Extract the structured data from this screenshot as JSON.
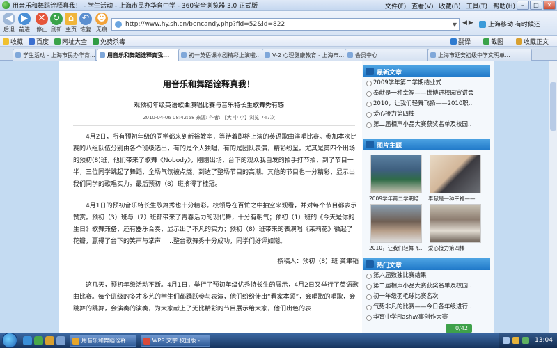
{
  "window": {
    "title": "用音乐和舞蹈诠释真我！ - 学生活动 - 上海市民办华育中学 - 360安全浏览器 3.0 正式版"
  },
  "menu": [
    "文件(F)",
    "查看(V)",
    "收藏(B)",
    "工具(T)",
    "帮助(H)"
  ],
  "nav": {
    "back": "后退",
    "forward": "前进",
    "stop": "停止",
    "refresh": "刷新",
    "home": "主页",
    "restore": "恢复",
    "no_image": "无痕",
    "url": "http://www.hy.sh.cn/bencandy.php?fid=52&id=822",
    "mobile": "上海移动 有时候还"
  },
  "favorites": {
    "items": [
      "收藏",
      "百度",
      "网址大全",
      "免费杀毒"
    ],
    "right": [
      "翻译",
      "截图",
      "收藏正文"
    ]
  },
  "tabs": [
    "学生活动 - 上海市民办华育...",
    "用音乐和舞蹈诠释真我...",
    "初一英语课本剧精彩上演啦...",
    "V-2 心理健康教育 - 上海市...",
    "会员中心",
    "上海市延安初级中学文明单..."
  ],
  "article": {
    "title": "用音乐和舞蹈诠释真我！",
    "subtitle": "观预初年级英语歌曲演唱比赛与音乐特长生歌舞秀有感",
    "meta": "2010-04-06 08:42:58 来源: 作者: 【大 中 小】浏览:747次",
    "p1": "4月2日，所有预初年级的同学都来到新裕教室，等待着即将上演的英语歌曲演唱比赛。参加本次比赛的八组队伍分别由各个班级选出，有的是个人独唱，有的是团队表演，精彩纷呈。尤其是第四个出场的预初(8)班，他们带来了歌舞《Nobody》，刚刚出场，台下的观众我自发的拍手打节拍，到了节目一半，三位同学跳起了舞蹈，全场气氛被点燃，到达了整场节目的高潮。其他的节目也十分精彩，显示出我们同学的歌唱实力。最后预初（8）班摘得了桂冠。",
    "p2": "4月1日的预初音乐特长生歌舞秀也十分精彩。校领导在百忙之中抽空来观看，并对每个节目都表示赞赏。预初（3）班与（7）班都带来了青春活力的现代舞，十分有朝气；预初（1）班的《今天是你的生日》歌舞兼备，还有器乐合奏，显示出了不凡的实力；预初（8）班带来的表演唱《茉莉花》徽起了花瓣，赢得了台下的笑声与掌声……整台歌舞秀十分成功，同学们好评如潮。",
    "sign": "撰稿人：预初（8）班 龚聿韬",
    "p3": "这几天，预初年级活动不断。4月1日，举行了预初年级优秀特长生的展示，4月2日又举行了英语歌曲比赛。每个班级的多才多艺的学生们都踊跃参与表演，他们纷纷使出“看家本领”，会唱歌的唱歌，会跳舞的跳舞，会演奏的演奏，为大家献上了无比精彩的节目展示给大家，他们出色的表"
  },
  "sidebar": {
    "latest_head": "最新文章",
    "latest": [
      "2009学年第二学期结业式",
      "奉献是一种幸福——世博进校园宣讲会",
      "2010，让我们轻舞飞扬——2010职..",
      "爱心接力第四棒",
      "第二届相声小品大赛获奖名单及校园.."
    ],
    "photo_head": "图片主题",
    "photos": [
      "2009学年第二学期结..",
      "奉献是一种幸福——..",
      "2010，让我们轻舞飞..",
      "爱心接力第四棒"
    ],
    "hot_head": "热门文章",
    "hot": [
      "第六届数独比赛结果",
      "第二届相声小品大赛获奖名单及校园..",
      "初一年级羽毛球比赛名次",
      "气势非凡的比赛——今日各年级进行..",
      "华育中学Flash故事创作大赛"
    ]
  },
  "status": {
    "progress": "0/42"
  },
  "taskbar": {
    "tasks": [
      "用音乐和舞蹈诠释...",
      "WPS 文字 校园版 -..."
    ],
    "clock": "13:04"
  },
  "colors": {
    "accent": "#1f78c8",
    "taskbar": "#16335d",
    "page_bg": "#c4dbf2"
  }
}
